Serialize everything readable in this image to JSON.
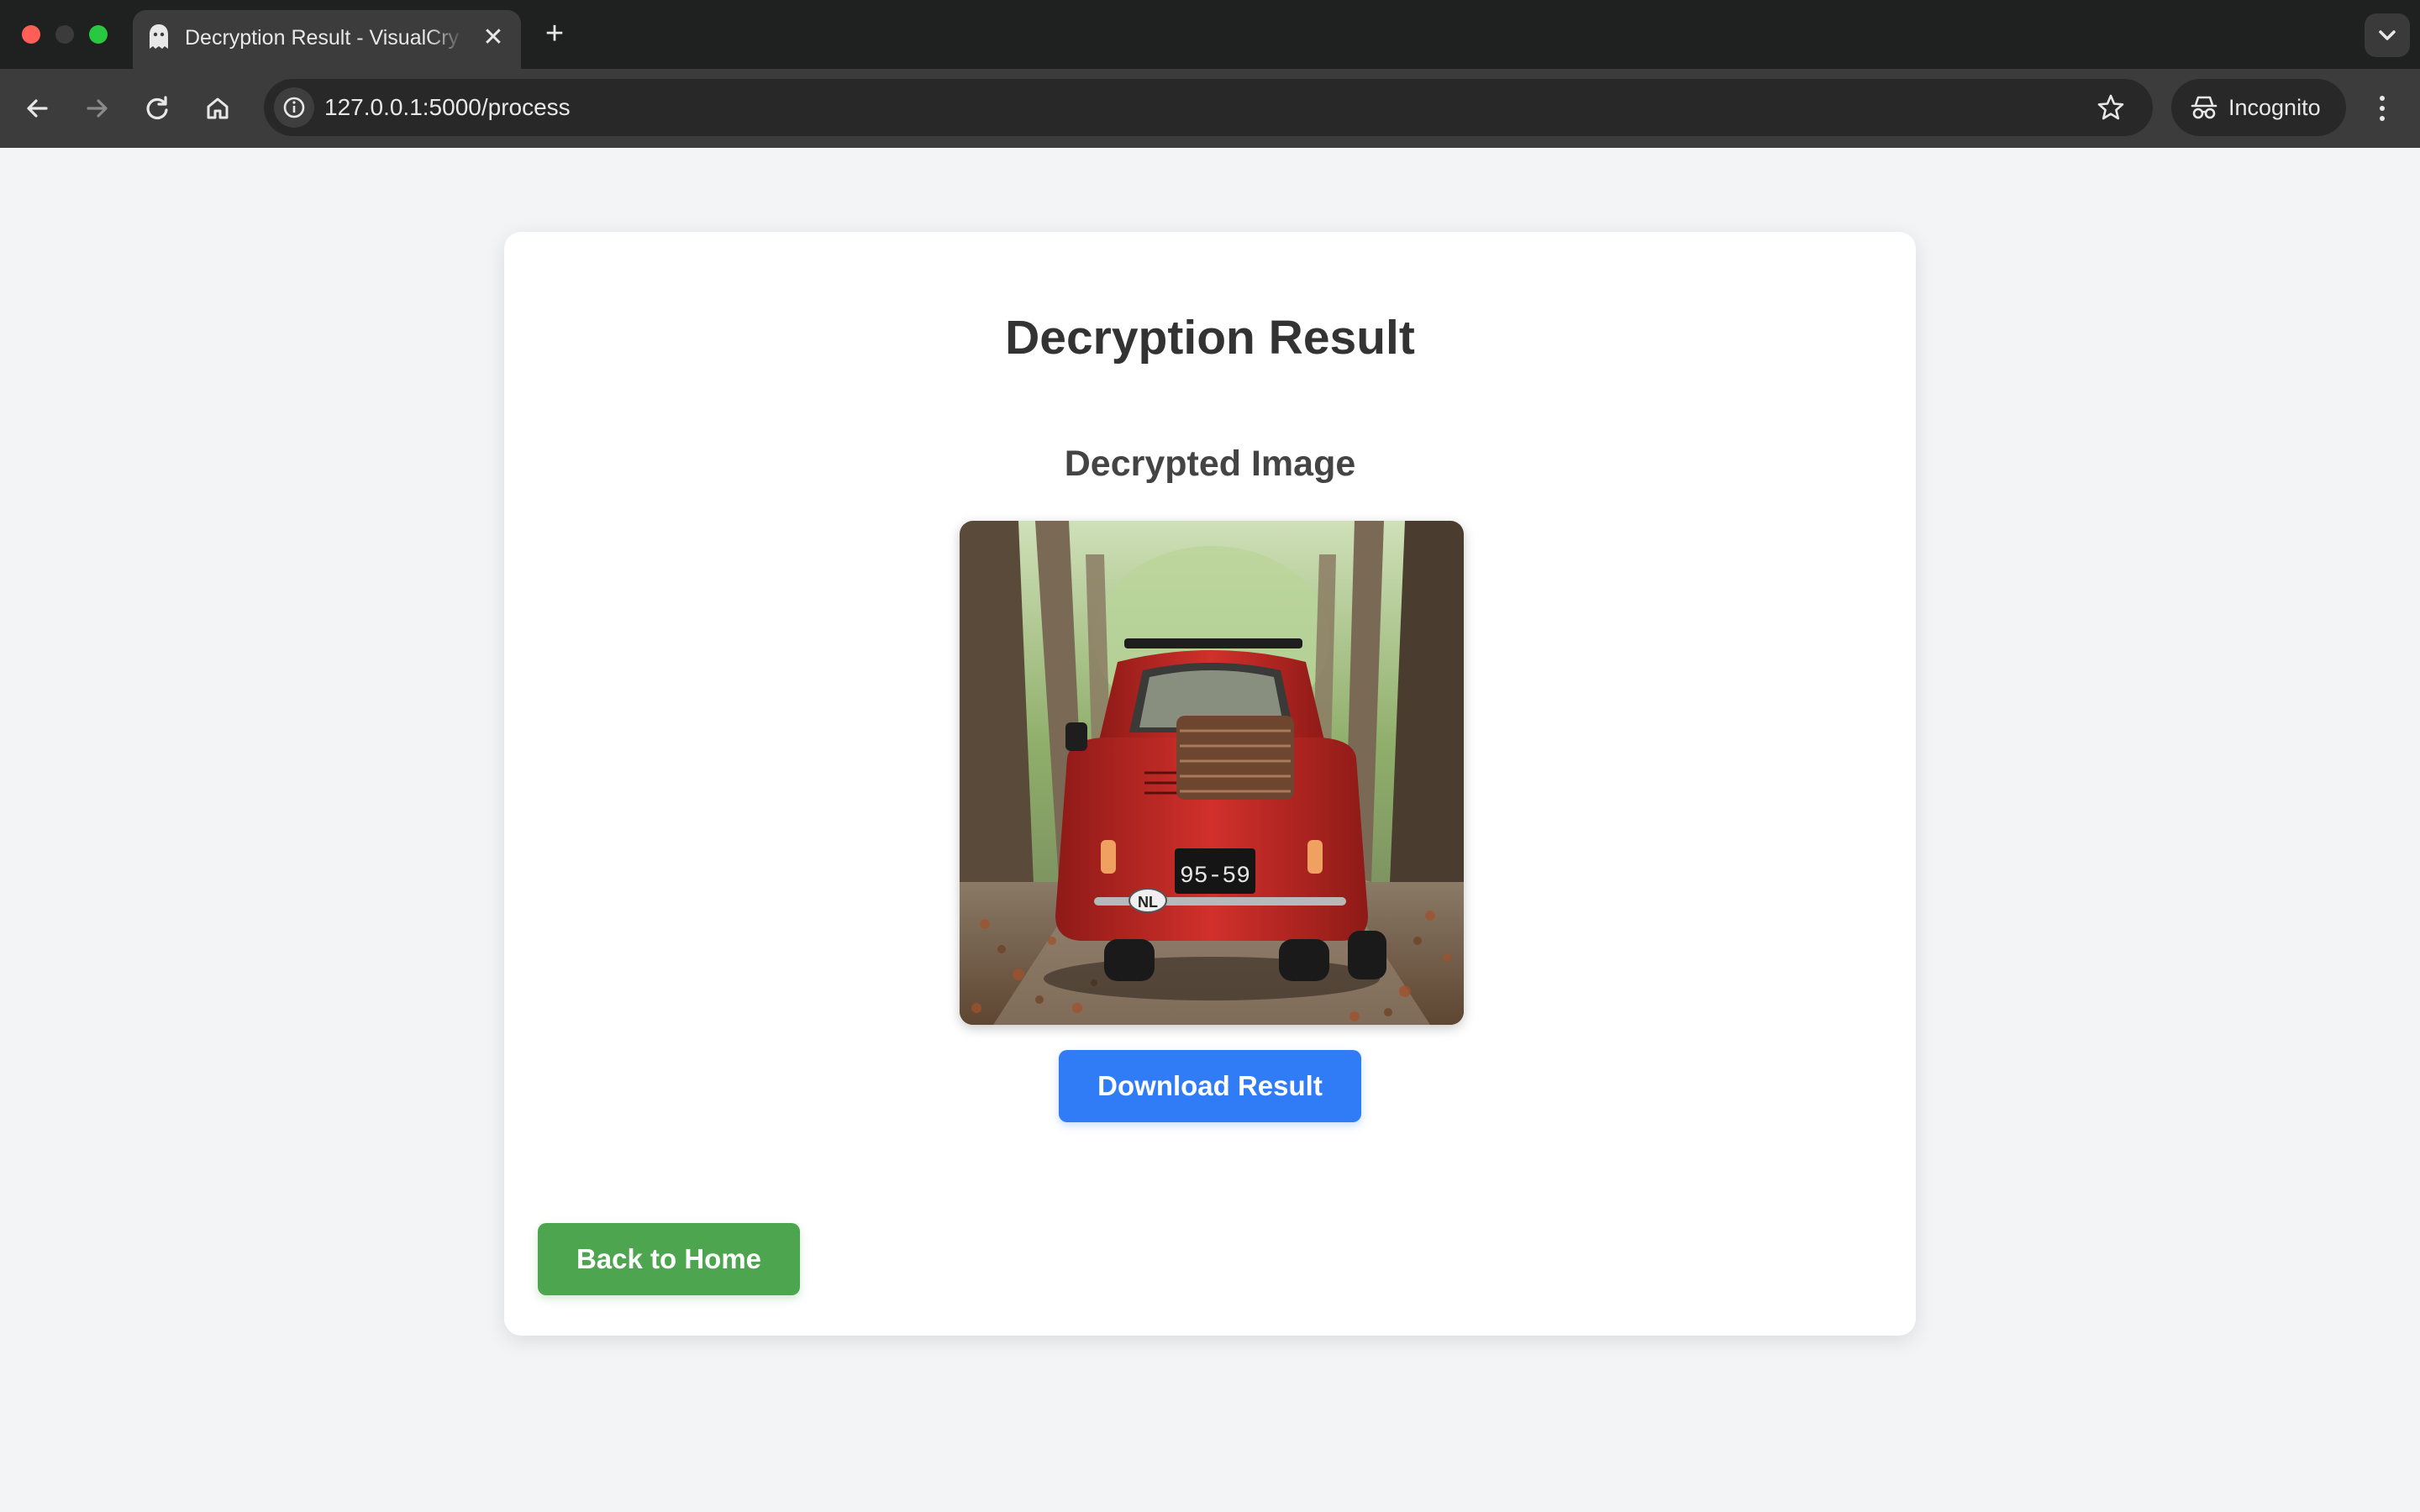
{
  "browser": {
    "tab": {
      "title": "Decryption Result - VisualCry",
      "icon": "ghost-icon",
      "close_icon": "close-icon"
    },
    "new_tab_icon": "plus-icon",
    "tab_menu_icon": "chevron-down-icon",
    "nav_icons": [
      "back-arrow-icon",
      "forward-arrow-icon",
      "reload-icon",
      "home-icon"
    ],
    "address_bar": {
      "site_info_icon": "info-icon",
      "url": "127.0.0.1:5000/process",
      "bookmark_icon": "star-icon"
    },
    "profile": {
      "label": "Incognito",
      "icon": "incognito-icon"
    },
    "menu_icon": "more-vertical-icon"
  },
  "page": {
    "title": "Decryption Result",
    "section_title": "Decrypted Image",
    "image": {
      "plate": "95-59",
      "country_badge": "NL"
    },
    "download_label": "Download Result",
    "back_label": "Back to Home"
  },
  "colors": {
    "page_background": "#f3f4f6",
    "download_button": "#2f7cf6",
    "back_button": "#4ea54f",
    "car": "#c52a26"
  }
}
